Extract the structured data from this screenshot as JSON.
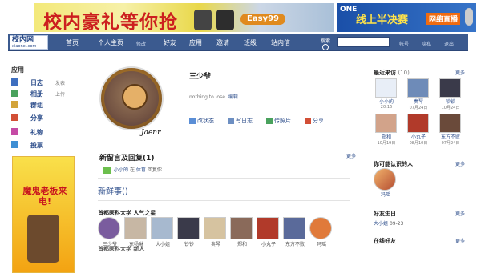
{
  "banner": {
    "promo_text": "校内豪礼等你抢",
    "promo_tag": "Easy99",
    "right_a": "ONE",
    "right_b": "线上半决赛",
    "right_c": "网络直播"
  },
  "nav": {
    "logo": "校内网",
    "logo_sub": "xiaonei.com",
    "items": [
      "首页",
      "个人主页",
      "修改",
      "好友",
      "应用",
      "邀请",
      "班级",
      "站内信"
    ],
    "search_label": "搜索",
    "right_items": [
      "帐号",
      "隐私",
      "退出"
    ]
  },
  "left": {
    "title": "应用",
    "apps": [
      {
        "label": "日志",
        "extra": "发表",
        "color": "#3e6fc0"
      },
      {
        "label": "相册",
        "extra": "上传",
        "color": "#4aa25d"
      },
      {
        "label": "群组",
        "extra": "",
        "color": "#d3a43a"
      },
      {
        "label": "分享",
        "extra": "",
        "color": "#d24f36"
      },
      {
        "label": "礼物",
        "extra": "",
        "color": "#c54aa5"
      },
      {
        "label": "投票",
        "extra": "",
        "color": "#3f8fd4"
      }
    ],
    "ad_text": "魔鬼老板来电!"
  },
  "main": {
    "avatar_caption": "Jaenr",
    "name": "三少爷",
    "status": "nothing to lose",
    "status_edit": "编辑",
    "actions": [
      "改状态",
      "写日志",
      "传照片",
      "分享"
    ],
    "messages_title": "新留言及回复(1)",
    "more": "更多",
    "msg_from": "小小的",
    "msg_at": "在",
    "msg_where": "体育",
    "msg_reply": "回复你",
    "news_title": "新鲜事()",
    "popular_title": "首都医科大学 人气之星",
    "popular": [
      {
        "name": "三少爷",
        "color": "#7a5c9e"
      },
      {
        "name": "东杨琳",
        "color": "#c7b7a4"
      },
      {
        "name": "大小姐",
        "color": "#a7b9cf"
      },
      {
        "name": "钞钞",
        "color": "#3a3a4a"
      },
      {
        "name": "奏琴",
        "color": "#d6c3a0"
      },
      {
        "name": "郑和",
        "color": "#8a6a5a"
      },
      {
        "name": "小丸子",
        "color": "#b13a2a"
      },
      {
        "name": "东方不败",
        "color": "#5a6a9a"
      },
      {
        "name": "玛瑶",
        "color": "#e07a3a"
      }
    ],
    "cut_text": "首都医科大学 新人"
  },
  "right": {
    "visitors_title": "最近来访",
    "visitors_count": "(10)",
    "more": "更多",
    "visitors": [
      {
        "name": "小小的",
        "date": "20:16",
        "color": "#e8eef7"
      },
      {
        "name": "奏琴",
        "date": "07月24日",
        "color": "#6e8bb8"
      },
      {
        "name": "钞钞",
        "date": "10月24日",
        "color": "#3a3a4a"
      },
      {
        "name": "郑和",
        "date": "10月19日",
        "color": "#d2a38a"
      },
      {
        "name": "小丸子",
        "date": "08月10日",
        "color": "#b13a2a"
      },
      {
        "name": "东方不败",
        "date": "07月24日",
        "color": "#6a4a3a"
      }
    ],
    "maybe_title": "你可能认识的人",
    "maybe_name": "玛瑶",
    "birthday_title": "好友生日",
    "birthday_name": "大小姐",
    "birthday_date": "09-23",
    "online_title": "在线好友"
  }
}
